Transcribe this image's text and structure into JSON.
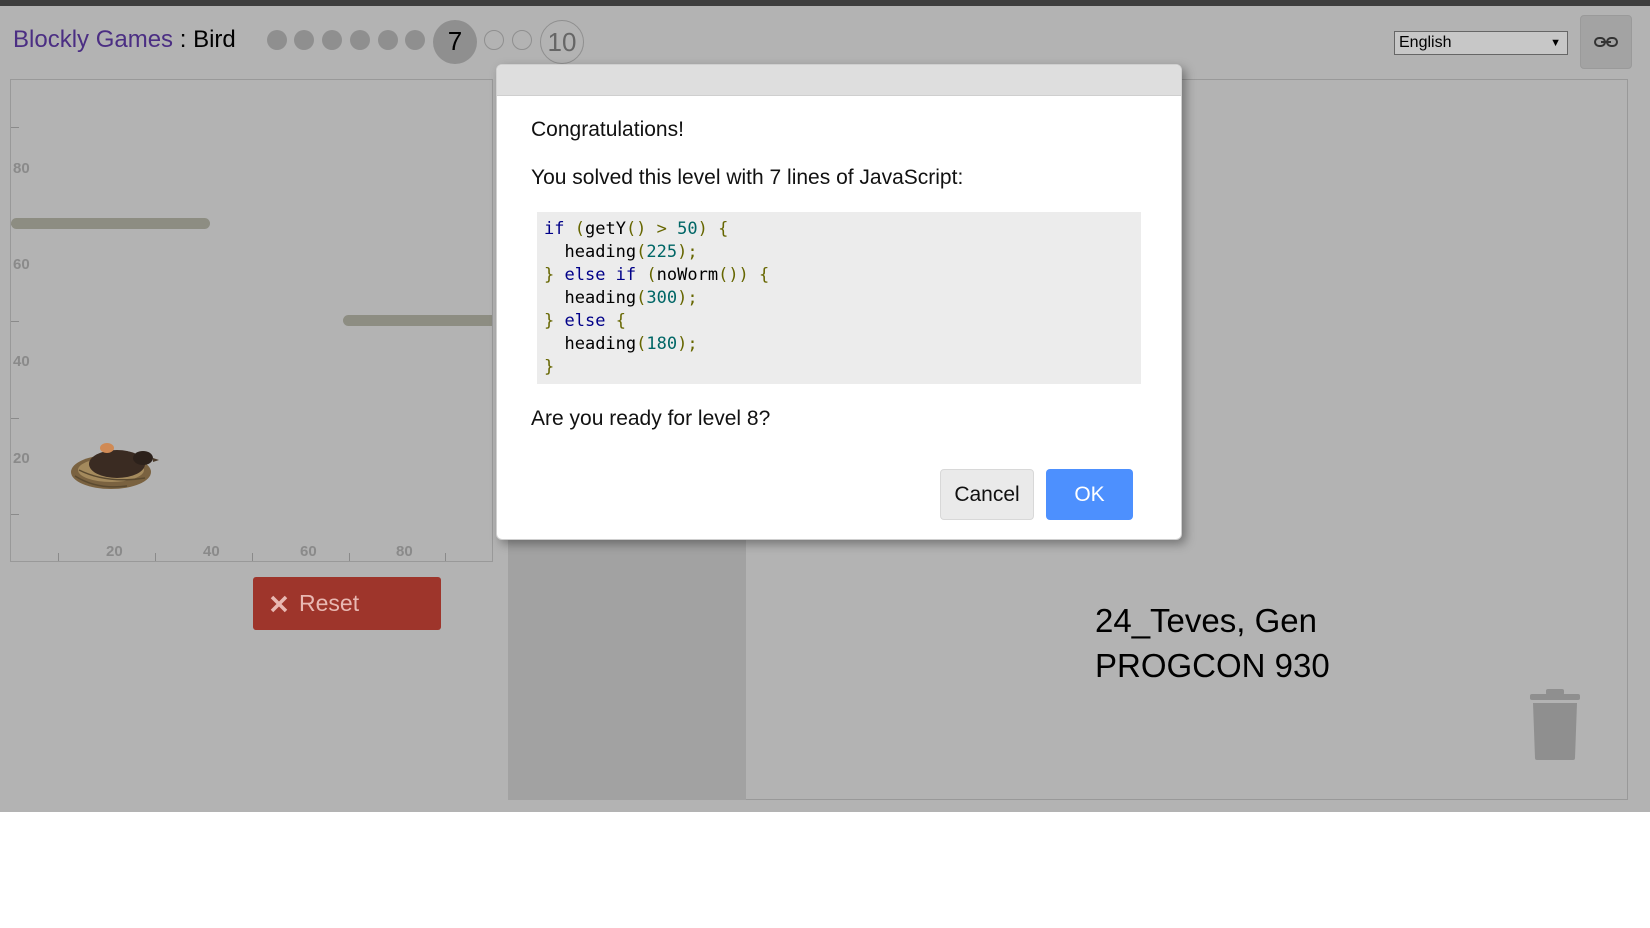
{
  "header": {
    "app_name": "Blockly Games",
    "separator": " : ",
    "game_name": "Bird",
    "levels": {
      "completed_count": 6,
      "current_label": "7",
      "remaining_count": 2,
      "last_label": "10"
    }
  },
  "language": {
    "selected": "English",
    "arrow": "▼"
  },
  "link_icon": "link-icon",
  "visualization": {
    "y_labels": [
      "80",
      "60",
      "40",
      "20"
    ],
    "x_labels": [
      "20",
      "40",
      "60",
      "80"
    ]
  },
  "reset": {
    "label": "Reset",
    "icon": "close-icon"
  },
  "watermark": {
    "line1": "24_Teves, Gen",
    "line2": "PROGCON 930"
  },
  "dialog": {
    "heading": "Congratulations!",
    "message": "You solved this level with 7 lines of JavaScript:",
    "code_lines": [
      "if (getY() > 50) {",
      "  heading(225);",
      "} else if (noWorm()) {",
      "  heading(300);",
      "} else {",
      "  heading(180);",
      "}"
    ],
    "question": "Are you ready for level 8?",
    "cancel_label": "Cancel",
    "ok_label": "OK"
  },
  "colors": {
    "ok_button": "#4d90fe",
    "reset_button": "#9e352b",
    "title_link": "#4b2e83"
  }
}
